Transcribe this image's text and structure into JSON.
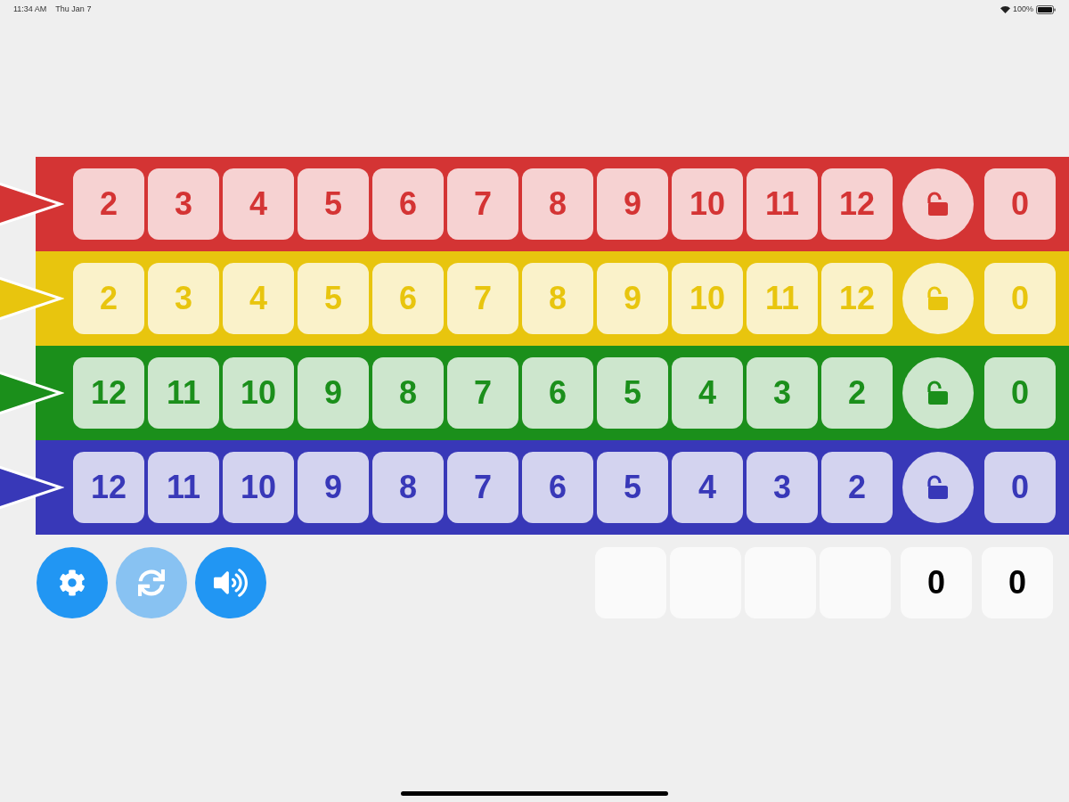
{
  "status_bar": {
    "time": "11:34 AM",
    "date": "Thu Jan 7",
    "battery": "100%"
  },
  "rows": [
    {
      "color": "#d43434",
      "cells": [
        "2",
        "3",
        "4",
        "5",
        "6",
        "7",
        "8",
        "9",
        "10",
        "11",
        "12"
      ],
      "locked": false,
      "score": "0"
    },
    {
      "color": "#e8c50e",
      "cells": [
        "2",
        "3",
        "4",
        "5",
        "6",
        "7",
        "8",
        "9",
        "10",
        "11",
        "12"
      ],
      "locked": false,
      "score": "0"
    },
    {
      "color": "#1b8f1b",
      "cells": [
        "12",
        "11",
        "10",
        "9",
        "8",
        "7",
        "6",
        "5",
        "4",
        "3",
        "2"
      ],
      "locked": false,
      "score": "0"
    },
    {
      "color": "#3838b8",
      "cells": [
        "12",
        "11",
        "10",
        "9",
        "8",
        "7",
        "6",
        "5",
        "4",
        "3",
        "2"
      ],
      "locked": false,
      "score": "0"
    }
  ],
  "buttons": [
    {
      "kind": "settings",
      "disabled": false
    },
    {
      "kind": "reset",
      "disabled": true
    },
    {
      "kind": "sound",
      "disabled": false
    }
  ],
  "score_boxes": [
    {
      "kind": "blank"
    },
    {
      "kind": "blank"
    },
    {
      "kind": "blank"
    },
    {
      "kind": "blank"
    },
    {
      "kind": "value",
      "value": "0"
    },
    {
      "kind": "value",
      "value": "0"
    }
  ]
}
